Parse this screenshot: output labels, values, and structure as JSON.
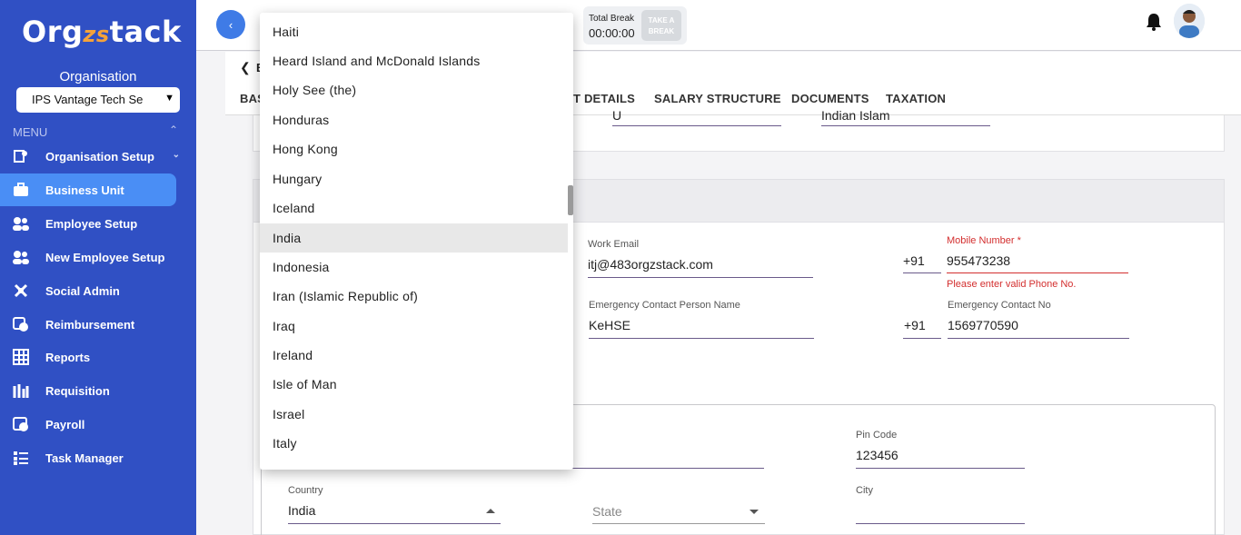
{
  "app": {
    "logo_main": "Org",
    "logo_mid": "zs",
    "logo_end": "tack"
  },
  "sidebar": {
    "org_label": "Organisation",
    "org_selected": "IPS Vantage Tech Se",
    "menu_label": "MENU",
    "items": [
      {
        "label": "Organisation Setup",
        "icon": "gear-org-icon"
      },
      {
        "label": "Business Unit",
        "icon": "briefcase-icon"
      },
      {
        "label": "Employee Setup",
        "icon": "users-icon"
      },
      {
        "label": "New Employee Setup",
        "icon": "users-plus-icon"
      },
      {
        "label": "Social Admin",
        "icon": "social-icon"
      },
      {
        "label": "Reimbursement",
        "icon": "reimburse-icon"
      },
      {
        "label": "Reports",
        "icon": "reports-icon"
      },
      {
        "label": "Requisition",
        "icon": "requisition-icon"
      },
      {
        "label": "Payroll",
        "icon": "payroll-icon"
      },
      {
        "label": "Task Manager",
        "icon": "task-icon"
      }
    ]
  },
  "header": {
    "break_title": "Total Break",
    "break_time": "00:00:00",
    "take_break_line1": "TAKE A",
    "take_break_line2": "BREAK"
  },
  "breadcrumb": {
    "text": "B"
  },
  "tabs": [
    {
      "label": "BAS"
    },
    {
      "label": "T DETAILS"
    },
    {
      "label": "SALARY STRUCTURE"
    },
    {
      "label": "DOCUMENTS"
    },
    {
      "label": "TAXATION"
    }
  ],
  "form": {
    "top_field_a": "U",
    "top_field_b": "Indian Islam",
    "work_email_label": "Work Email",
    "work_email": "itj@483orgzstack.com",
    "mobile_code": "+91",
    "mobile_label": "Mobile Number *",
    "mobile_value": "955473238",
    "mobile_error": "Please enter valid Phone No.",
    "emergency_name_label": "Emergency Contact Person Name",
    "emergency_name": "KeHSE",
    "emergency_code": "+91",
    "emergency_no_label": "Emergency Contact No",
    "emergency_no": "1569770590",
    "pin_label": "Pin Code",
    "pin_value": "123456",
    "country_label": "Country",
    "country_value": "India",
    "state_placeholder": "State",
    "city_label": "City"
  },
  "dropdown": {
    "options": [
      "Haiti",
      "Heard Island and McDonald Islands",
      "Holy See (the)",
      "Honduras",
      "Hong Kong",
      "Hungary",
      "Iceland",
      "India",
      "Indonesia",
      "Iran (Islamic Republic of)",
      "Iraq",
      "Ireland",
      "Isle of Man",
      "Israel",
      "Italy"
    ],
    "selected": "India"
  }
}
